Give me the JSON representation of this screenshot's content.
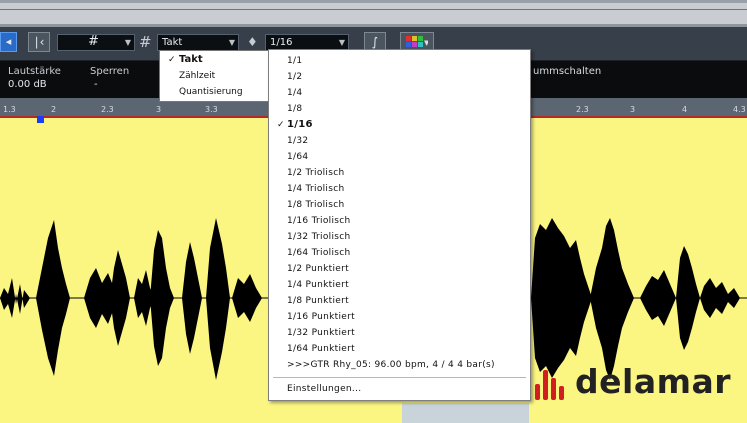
{
  "toolbar": {
    "snap_type": "Takt",
    "quantize_value": "1/16",
    "grid_icon": "grid-icon",
    "colors_icon": "color-palette-icon"
  },
  "infoline": {
    "volume_label": "Lautstärke",
    "volume_value": "0.00 dB",
    "lock_label": "Sperren",
    "lock_value": "-",
    "switch_label": "ummschalten"
  },
  "ruler": {
    "ticks": [
      "1.3",
      "2",
      "2.3",
      "3",
      "3.3",
      "4",
      "4.3"
    ]
  },
  "grid_type_menu": {
    "items": [
      {
        "label": "Takt",
        "checked": true
      },
      {
        "label": "Zählzeit",
        "checked": false
      },
      {
        "label": "Quantisierung",
        "checked": false
      }
    ]
  },
  "quantize_menu": {
    "items": [
      {
        "label": "1/1",
        "checked": false
      },
      {
        "label": "1/2",
        "checked": false
      },
      {
        "label": "1/4",
        "checked": false
      },
      {
        "label": "1/8",
        "checked": false
      },
      {
        "label": "1/16",
        "checked": true
      },
      {
        "label": "1/32",
        "checked": false
      },
      {
        "label": "1/64",
        "checked": false
      },
      {
        "label": "1/2 Triolisch",
        "checked": false
      },
      {
        "label": "1/4 Triolisch",
        "checked": false
      },
      {
        "label": "1/8 Triolisch",
        "checked": false
      },
      {
        "label": "1/16 Triolisch",
        "checked": false
      },
      {
        "label": "1/32 Triolisch",
        "checked": false
      },
      {
        "label": "1/64 Triolisch",
        "checked": false
      },
      {
        "label": "1/2 Punktiert",
        "checked": false
      },
      {
        "label": "1/4 Punktiert",
        "checked": false
      },
      {
        "label": "1/8 Punktiert",
        "checked": false
      },
      {
        "label": "1/16 Punktiert",
        "checked": false
      },
      {
        "label": "1/32 Punktiert",
        "checked": false
      },
      {
        "label": "1/64 Punktiert",
        "checked": false
      },
      {
        "label": ">>>GTR Rhy_05: 96.00 bpm, 4 / 4  4 bar(s)",
        "checked": false
      }
    ],
    "settings_label": "Einstellungen..."
  },
  "logo": {
    "text": "delamar"
  },
  "colors": {
    "wave_bg": "#fbf582",
    "wave": "#000000",
    "ruler_line": "#b22a2a",
    "marker": "#1a3cff",
    "logo_red": "#d11e1e"
  }
}
